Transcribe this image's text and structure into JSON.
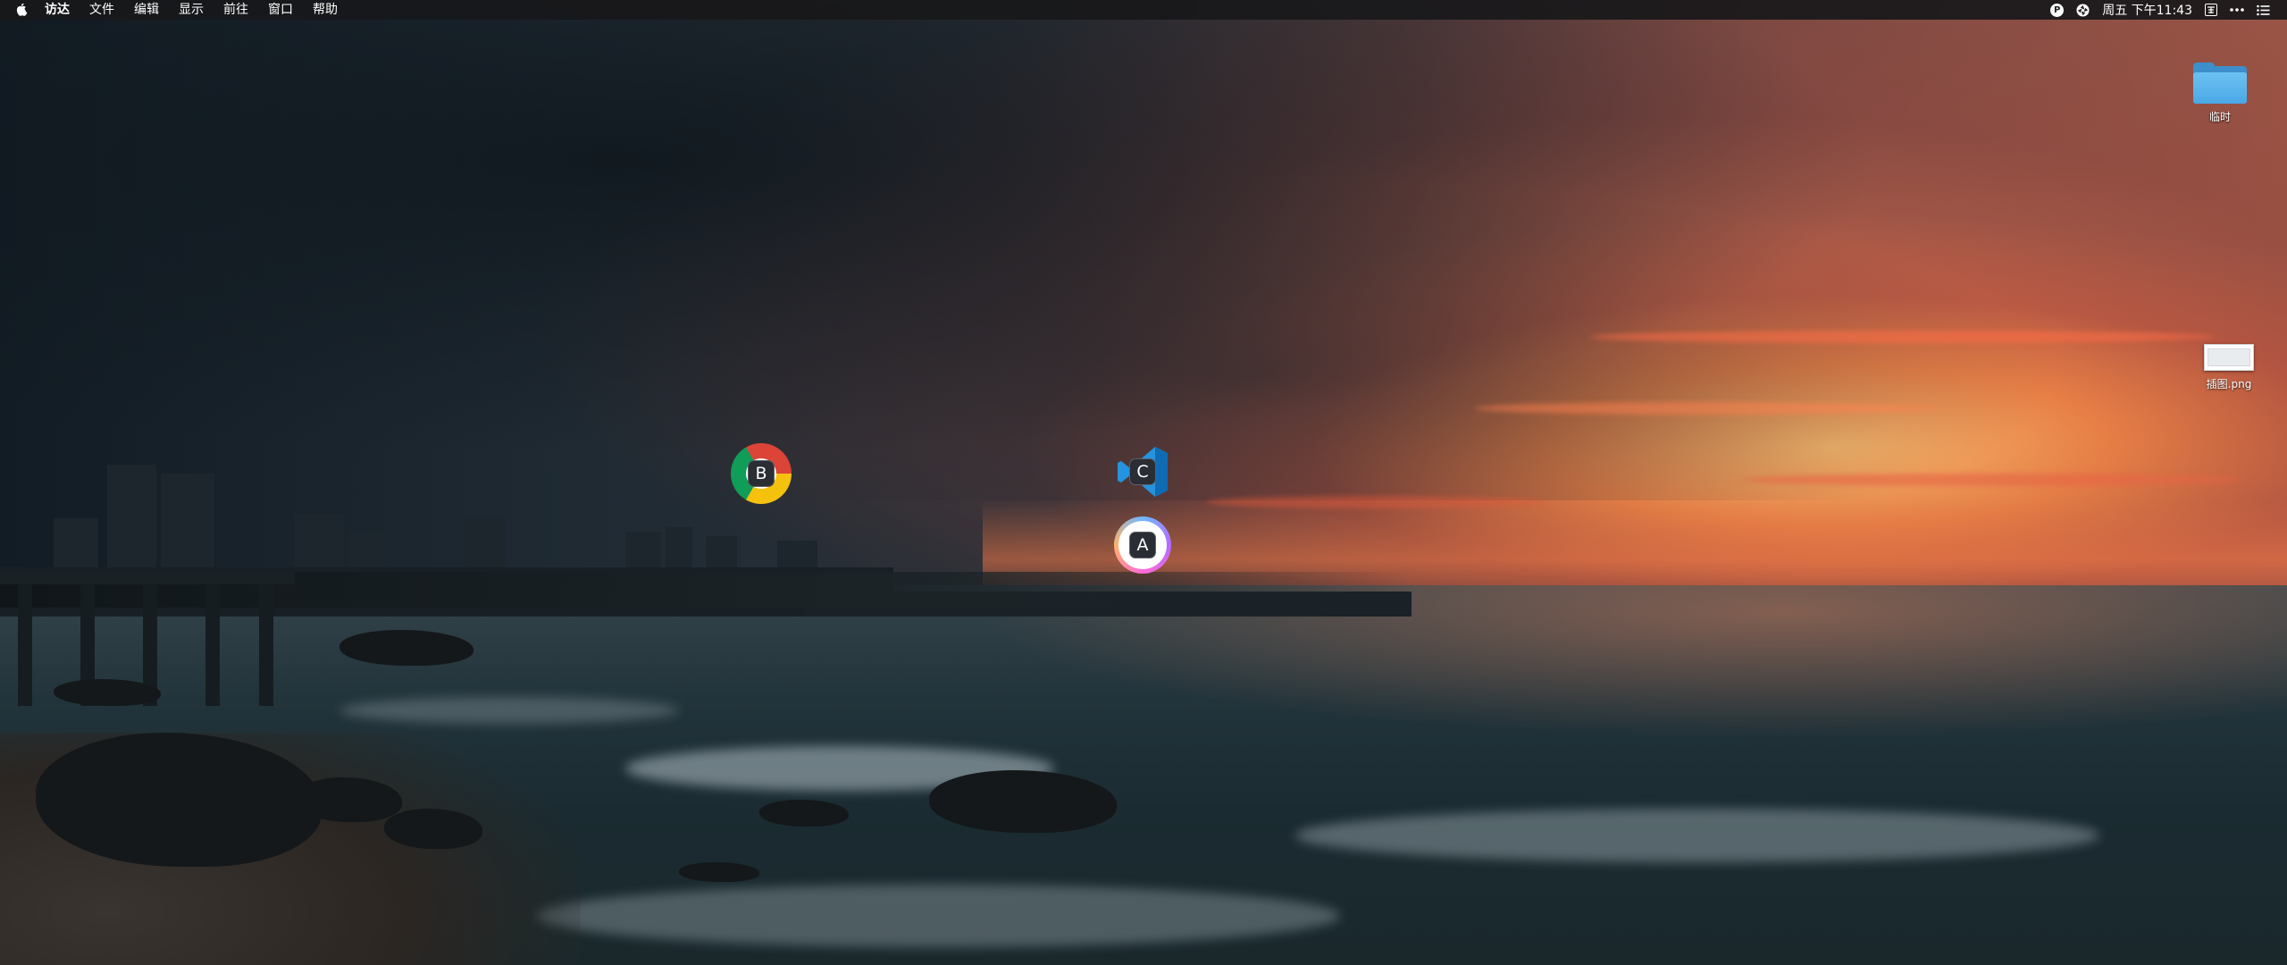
{
  "menubar": {
    "apple_icon": "apple-logo-icon",
    "app_name": "访达",
    "items": [
      "文件",
      "编辑",
      "显示",
      "前往",
      "窗口",
      "帮助"
    ],
    "status": {
      "p_icon_letter": "P",
      "clock": "周五 下午11:43"
    }
  },
  "desktop": {
    "folder_label": "临时",
    "png_label": "插图.png"
  },
  "floating_badges": {
    "chrome_letter": "B",
    "vscode_letter": "C",
    "app_letter": "A"
  }
}
